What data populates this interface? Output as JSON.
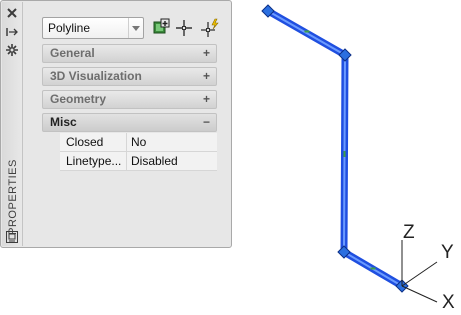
{
  "sidebar": {
    "title": "PROPERTIES",
    "icons": [
      "close-icon",
      "auto-hide-icon",
      "settings-icon",
      "customize-icon"
    ]
  },
  "selector": {
    "value": "Polyline"
  },
  "toolbar": {
    "icons": [
      "toggle-pickadd-icon",
      "select-objects-icon",
      "quick-select-icon"
    ]
  },
  "sections": [
    {
      "label": "General",
      "sign": "+"
    },
    {
      "label": "3D Visualization",
      "sign": "+"
    },
    {
      "label": "Geometry",
      "sign": "+"
    },
    {
      "label": "Misc",
      "sign": "−"
    }
  ],
  "misc_properties": [
    {
      "name": "Closed",
      "value": "No"
    },
    {
      "name": "Linetype...",
      "value": "Disabled"
    }
  ],
  "viewport": {
    "axis_labels": {
      "z": "Z",
      "y": "Y",
      "x": "X"
    },
    "colors": {
      "selection": "#1f4fe0",
      "highlight": "#6b9bff",
      "grip": "#2b6fe0"
    }
  }
}
